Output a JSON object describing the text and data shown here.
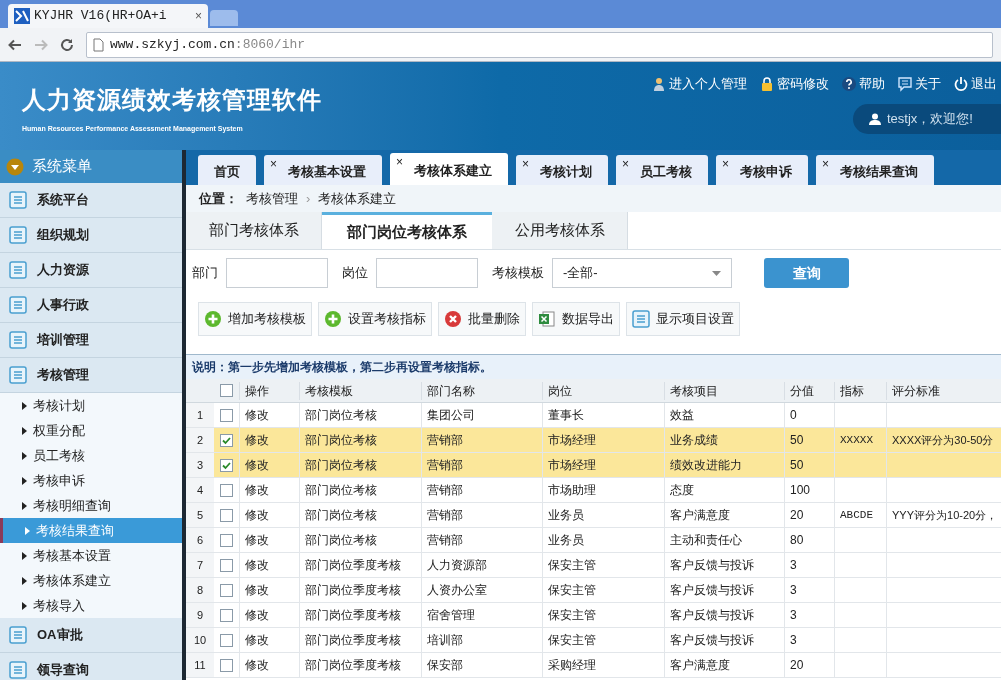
{
  "browser": {
    "tab_title": "KYJHR V16(HR+OA+i",
    "tab_close": "×",
    "url_host": "www.szkyj.com.cn",
    "url_path": ":8060/ihr"
  },
  "header": {
    "title": "人力资源绩效考核管理软件",
    "subtitle": "Human Resources Performance Assessment Management System",
    "links": [
      {
        "kind": "person",
        "label": "进入个人管理"
      },
      {
        "kind": "lock",
        "label": "密码修改"
      },
      {
        "kind": "help",
        "label": "帮助"
      },
      {
        "kind": "chat",
        "label": "关于"
      },
      {
        "kind": "power",
        "label": "退出"
      }
    ],
    "welcome": "testjx，欢迎您!"
  },
  "sidebar": {
    "title": "系统菜单",
    "groups": [
      {
        "label": "系统平台"
      },
      {
        "label": "组织规划"
      },
      {
        "label": "人力资源"
      },
      {
        "label": "人事行政"
      },
      {
        "label": "培训管理"
      },
      {
        "label": "考核管理",
        "children": [
          {
            "label": "考核计划",
            "selected": false
          },
          {
            "label": "权重分配",
            "selected": false
          },
          {
            "label": "员工考核",
            "selected": false
          },
          {
            "label": "考核申诉",
            "selected": false
          },
          {
            "label": "考核明细查询",
            "selected": false
          },
          {
            "label": "考核结果查询",
            "selected": true
          },
          {
            "label": "考核基本设置",
            "selected": false
          },
          {
            "label": "考核体系建立",
            "selected": false
          },
          {
            "label": "考核导入",
            "selected": false
          }
        ]
      },
      {
        "label": "OA审批"
      },
      {
        "label": "领导查询"
      }
    ]
  },
  "page_tabs": [
    {
      "label": "首页",
      "closable": false,
      "selected": false
    },
    {
      "label": "考核基本设置",
      "closable": true,
      "selected": false
    },
    {
      "label": "考核体系建立",
      "closable": true,
      "selected": true
    },
    {
      "label": "考核计划",
      "closable": true,
      "selected": false
    },
    {
      "label": "员工考核",
      "closable": true,
      "selected": false
    },
    {
      "label": "考核申诉",
      "closable": true,
      "selected": false
    },
    {
      "label": "考核结果查询",
      "closable": true,
      "selected": false
    }
  ],
  "close_mark": "×",
  "breadcrumb": {
    "label": "位置：",
    "items": [
      "考核管理",
      "考核体系建立"
    ],
    "separator": "›"
  },
  "sub_tabs": [
    {
      "label": "部门考核体系",
      "selected": false
    },
    {
      "label": "部门岗位考核体系",
      "selected": true
    },
    {
      "label": "公用考核体系",
      "selected": false
    }
  ],
  "filters": {
    "department_label": "部门",
    "position_label": "岗位",
    "template_label": "考核模板",
    "template_value": "-全部-",
    "query_button": "查询"
  },
  "actions": [
    {
      "kind": "add",
      "label": "增加考核模板"
    },
    {
      "kind": "add",
      "label": "设置考核指标"
    },
    {
      "kind": "delete",
      "label": "批量删除"
    },
    {
      "kind": "excel",
      "label": "数据导出"
    },
    {
      "kind": "list",
      "label": "显示项目设置"
    }
  ],
  "note": "说明：第一步先增加考核模板，第二步再设置考核指标。",
  "table": {
    "all_checked": false,
    "columns": [
      "操作",
      "考核模板",
      "部门名称",
      "岗位",
      "考核项目",
      "分值",
      "指标",
      "评分标准"
    ],
    "rows": [
      {
        "index": "1",
        "selected": false,
        "cells": [
          "修改",
          "部门岗位考核",
          "集团公司",
          "董事长",
          "效益",
          "0",
          "",
          ""
        ]
      },
      {
        "index": "2",
        "selected": true,
        "cells": [
          "修改",
          "部门岗位考核",
          "营销部",
          "市场经理",
          "业务成绩",
          "50",
          "XXXXX",
          "XXXX评分为30-50分"
        ]
      },
      {
        "index": "3",
        "selected": true,
        "cells": [
          "修改",
          "部门岗位考核",
          "营销部",
          "市场经理",
          "绩效改进能力",
          "50",
          "",
          ""
        ]
      },
      {
        "index": "4",
        "selected": false,
        "cells": [
          "修改",
          "部门岗位考核",
          "营销部",
          "市场助理",
          "态度",
          "100",
          "",
          ""
        ]
      },
      {
        "index": "5",
        "selected": false,
        "cells": [
          "修改",
          "部门岗位考核",
          "营销部",
          "业务员",
          "客户满意度",
          "20",
          "ABCDE",
          "YYY评分为10-20分，"
        ]
      },
      {
        "index": "6",
        "selected": false,
        "cells": [
          "修改",
          "部门岗位考核",
          "营销部",
          "业务员",
          "主动和责任心",
          "80",
          "",
          ""
        ]
      },
      {
        "index": "7",
        "selected": false,
        "cells": [
          "修改",
          "部门岗位季度考核",
          "人力资源部",
          "保安主管",
          "客户反馈与投诉",
          "3",
          "",
          ""
        ]
      },
      {
        "index": "8",
        "selected": false,
        "cells": [
          "修改",
          "部门岗位季度考核",
          "人资办公室",
          "保安主管",
          "客户反馈与投诉",
          "3",
          "",
          ""
        ]
      },
      {
        "index": "9",
        "selected": false,
        "cells": [
          "修改",
          "部门岗位季度考核",
          "宿舍管理",
          "保安主管",
          "客户反馈与投诉",
          "3",
          "",
          ""
        ]
      },
      {
        "index": "10",
        "selected": false,
        "cells": [
          "修改",
          "部门岗位季度考核",
          "培训部",
          "保安主管",
          "客户反馈与投诉",
          "3",
          "",
          ""
        ]
      },
      {
        "index": "11",
        "selected": false,
        "cells": [
          "修改",
          "部门岗位季度考核",
          "保安部",
          "采购经理",
          "客户满意度",
          "20",
          "",
          ""
        ]
      }
    ]
  }
}
